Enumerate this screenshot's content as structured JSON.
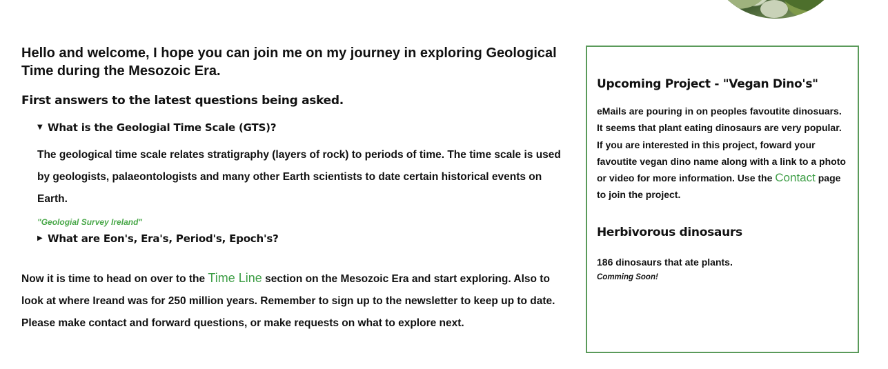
{
  "header": {
    "photo_icon": "circular-nature-photo"
  },
  "main": {
    "intro": "Hello and welcome, I hope you can join me on my journey in exploring Geological Time during the Mesozoic Era.",
    "section_heading": "First answers to the latest questions being asked.",
    "faqs": [
      {
        "question": "What is the Geologial Time Scale (GTS)?",
        "expanded": true,
        "marker": "▼",
        "answer": "The geological time scale relates stratigraphy (layers of rock) to periods of time. The time scale is used by geologists, palaeontologists and many other Earth scientists to date certain historical events on Earth.",
        "source": "\"Geologial Survey Ireland\""
      },
      {
        "question": "What are Eon's, Era's, Period's, Epoch's?",
        "expanded": false,
        "marker": "▶"
      }
    ],
    "outro_before": "Now it is time to head on over to the ",
    "outro_link": "Time Line",
    "outro_after": " section on the Mesozoic Era and start exploring. Also to look at where Ireand was for 250 million years. Remember to sign up to the newsletter to keep up to date. Please make contact and forward questions, or make requests on what to explore next."
  },
  "sidebar": {
    "project_title": "Upcoming Project - \"Vegan Dino's\"",
    "project_text_before": "eMails are pouring in on peoples favoutite dinosuars. It seems that plant eating dinosaurs are very popular. If you are interested in this project, foward your favoutite vegan dino name along with a link to a photo or video for more information. Use the ",
    "project_link": "Contact",
    "project_text_after": " page to join the project.",
    "herb_title": "Herbivorous dinosaurs",
    "herb_count": "186 dinosaurs that ate plants.",
    "herb_soon": "Comming Soon!"
  },
  "colors": {
    "accent_green": "#3e9e46",
    "card_border": "#5a9a5a"
  }
}
